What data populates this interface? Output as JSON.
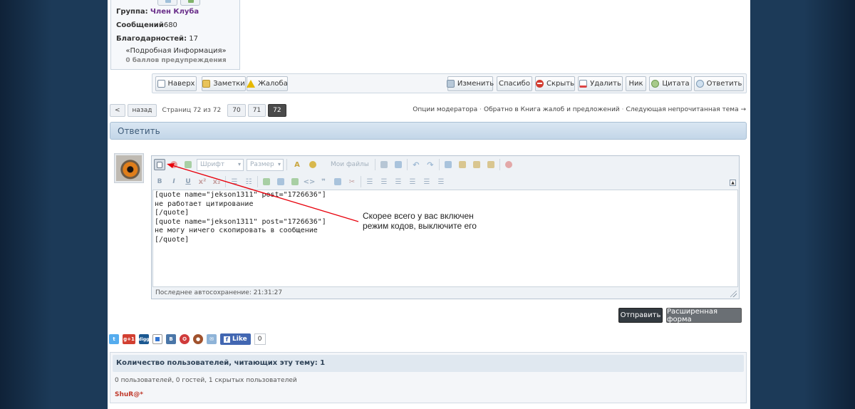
{
  "author": {
    "group_label": "Группа:",
    "group_value": "Член Клуба",
    "posts_label": "Сообщений",
    "posts_value": "680",
    "thanks_label": "Благодарностей:",
    "thanks_value": "17",
    "details_link": "«Подробная Информация»",
    "warnings": "0 баллов предупреждения"
  },
  "post_actions": {
    "top": "Наверх",
    "notes": "Заметки",
    "report": "Жалоба",
    "edit": "Изменить",
    "thanks": "Спасибо",
    "hide": "Скрыть",
    "delete": "Удалить",
    "nick": "Ник",
    "quote": "Цитата",
    "reply": "Ответить"
  },
  "pagination": {
    "prev_arrow": "<",
    "back": "назад",
    "label": "Страниц 72 из 72",
    "pages": [
      "70",
      "71",
      "72"
    ]
  },
  "moderator_links": {
    "options": "Опции модератора",
    "complaints": "Обратно в Книга жалоб и предложений",
    "next_unread": "Следующая непрочитанная тема →",
    "separator": "·"
  },
  "reply": {
    "header": "Ответить",
    "toolbar": {
      "font_select": "Шрифт",
      "size_select": "Размер",
      "my_files": "Мои файлы",
      "bold": "B",
      "italic": "I",
      "underline": "U"
    },
    "textarea_value": "[quote name=\"jekson1311\" post=\"1726636\"]\nне работает цитирование\n[/quote]\n[quote name=\"jekson1311\" post=\"1726636\"]\nне могу ничего скопировать в сообщение\n[/quote]",
    "autosave": "Последнее автосохранение: 21:31:27",
    "send": "Отправить",
    "advanced": "Расширенная форма"
  },
  "annotation": {
    "line1": "Скорее всего у вас включен",
    "line2": "режим кодов, выключите его",
    "color": "#e8000b"
  },
  "social": {
    "gplus": "g+1",
    "digg": "digg",
    "vk": "B",
    "fb_like": "Like",
    "fb_count": "0"
  },
  "readers": {
    "title": "Количество пользователей, читающих эту тему: 1",
    "subtitle": "0 пользователей, 0 гостей, 1 скрытых пользователей",
    "user": "ShuR@*"
  }
}
